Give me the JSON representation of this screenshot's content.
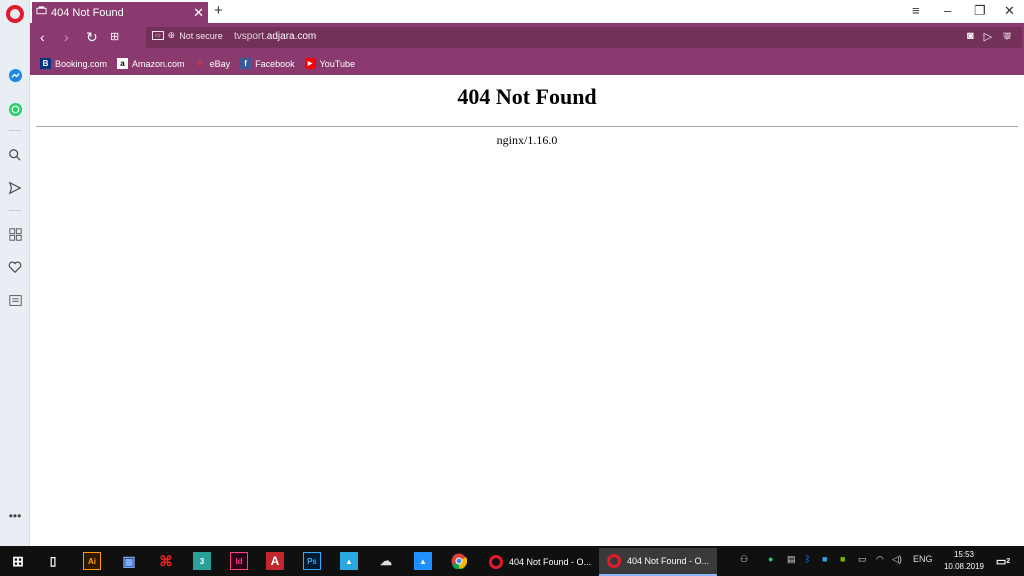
{
  "browser": {
    "tab": {
      "title": "404 Not Found"
    },
    "address": {
      "security": "Not secure",
      "url_host": "tvsport.",
      "url_domain": "adjara.com"
    },
    "bookmarks": [
      {
        "label": "Booking.com",
        "icon": "booking-icon",
        "color": "#003580"
      },
      {
        "label": "Amazon.com",
        "icon": "amazon-icon",
        "color": "#ffffff"
      },
      {
        "label": "eBay",
        "icon": "ebay-icon",
        "color": "#e53238"
      },
      {
        "label": "Facebook",
        "icon": "facebook-icon",
        "color": "#3b5998"
      },
      {
        "label": "YouTube",
        "icon": "youtube-icon",
        "color": "#ff0000"
      }
    ],
    "accent": "#8a3a6e"
  },
  "page": {
    "heading": "404 Not Found",
    "server": "nginx/1.16.0"
  },
  "taskbar": {
    "tasks": [
      {
        "label": "404 Not Found - O..."
      },
      {
        "label": "404 Not Found - O..."
      }
    ],
    "lang": "ENG",
    "time": "15:53",
    "date": "10.08.2019",
    "notifications": "2"
  }
}
